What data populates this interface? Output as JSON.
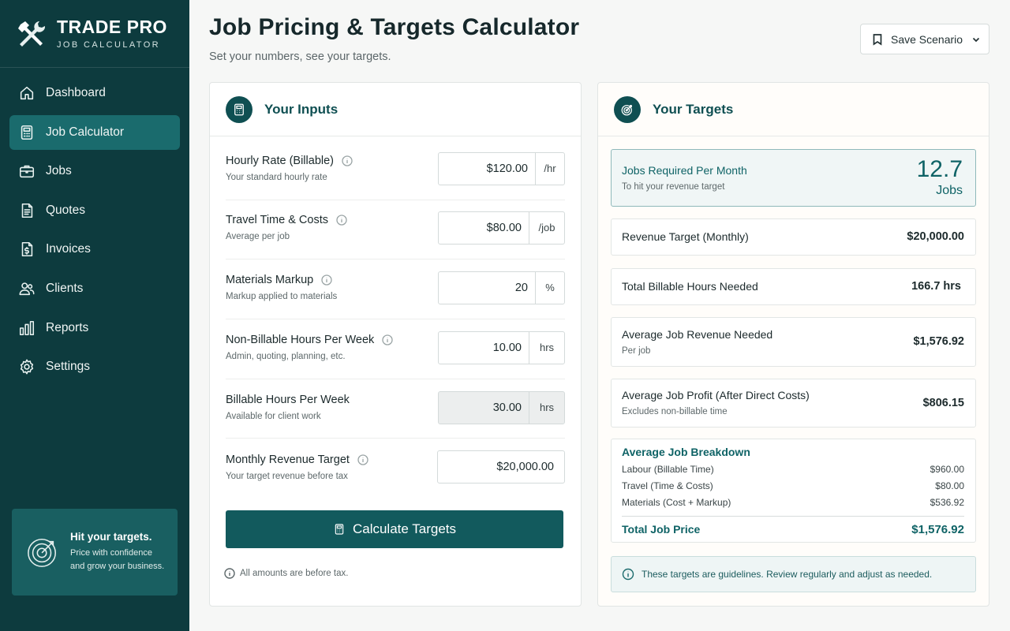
{
  "brand": {
    "title": "TRADE PRO",
    "subtitle": "JOB CALCULATOR"
  },
  "sidebar": {
    "items": [
      {
        "label": "Dashboard",
        "icon": "home-icon"
      },
      {
        "label": "Job Calculator",
        "icon": "calculator-icon",
        "active": true
      },
      {
        "label": "Jobs",
        "icon": "briefcase-icon"
      },
      {
        "label": "Quotes",
        "icon": "document-icon"
      },
      {
        "label": "Invoices",
        "icon": "invoice-icon"
      },
      {
        "label": "Clients",
        "icon": "users-icon"
      },
      {
        "label": "Reports",
        "icon": "bar-chart-icon"
      },
      {
        "label": "Settings",
        "icon": "gear-icon"
      }
    ],
    "promo": {
      "title": "Hit your targets.",
      "line1": "Price with confidence",
      "line2": "and grow your business."
    }
  },
  "header": {
    "title": "Job Pricing & Targets Calculator",
    "subtitle": "Set your numbers, see your targets.",
    "save_label": "Save Scenario"
  },
  "inputs": {
    "title": "Your Inputs",
    "rows": [
      {
        "label": "Hourly Rate (Billable)",
        "help": "Your standard hourly rate",
        "value": "$120.00",
        "unit": "/hr",
        "info": true
      },
      {
        "label": "Travel Time & Costs",
        "help": "Average per job",
        "value": "$80.00",
        "unit": "/job",
        "info": true
      },
      {
        "label": "Materials Markup",
        "help": "Markup applied to materials",
        "value": "20",
        "unit": "%",
        "info": true
      },
      {
        "label": "Non-Billable Hours Per Week",
        "help": "Admin, quoting, planning, etc.",
        "value": "10.00",
        "unit": "hrs",
        "info": true
      },
      {
        "label": "Billable Hours Per Week",
        "help": "Available for client work",
        "value": "30.00",
        "unit": "hrs",
        "info": false,
        "readonly": true
      },
      {
        "label": "Monthly Revenue Target",
        "help": "Your target revenue before tax",
        "value": "$20,000.00",
        "unit": "",
        "info": true
      }
    ],
    "calculate_label": "Calculate Targets",
    "note": "All amounts are before tax."
  },
  "targets": {
    "title": "Your Targets",
    "jobs_required": {
      "label": "Jobs Required Per Month",
      "sub": "To hit your revenue target",
      "value": "12.7",
      "unit": "Jobs"
    },
    "revenue_target": {
      "label": "Revenue Target (Monthly)",
      "value": "$20,000.00"
    },
    "billable_hours": {
      "label": "Total Billable Hours Needed",
      "value": "166.7 hrs"
    },
    "avg_revenue": {
      "label": "Average Job Revenue Needed",
      "sub": "Per job",
      "value": "$1,576.92"
    },
    "avg_profit": {
      "label": "Average Job Profit (After Direct Costs)",
      "sub": "Excludes non-billable time",
      "value": "$806.15"
    },
    "breakdown": {
      "title": "Average Job Breakdown",
      "rows": [
        {
          "label": "Labour (Billable Time)",
          "value": "$960.00"
        },
        {
          "label": "Travel (Time & Costs)",
          "value": "$80.00"
        },
        {
          "label": "Materials (Cost + Markup)",
          "value": "$536.92"
        }
      ],
      "total_label": "Total Job Price",
      "total_value": "$1,576.92"
    },
    "guideline": "These targets are guidelines. Review regularly and adjust as needed."
  },
  "colors": {
    "sidebar": "#0d3b3e",
    "accent": "#125a5d",
    "active": "#1a6b6d",
    "highlight_text": "#0f6366"
  }
}
